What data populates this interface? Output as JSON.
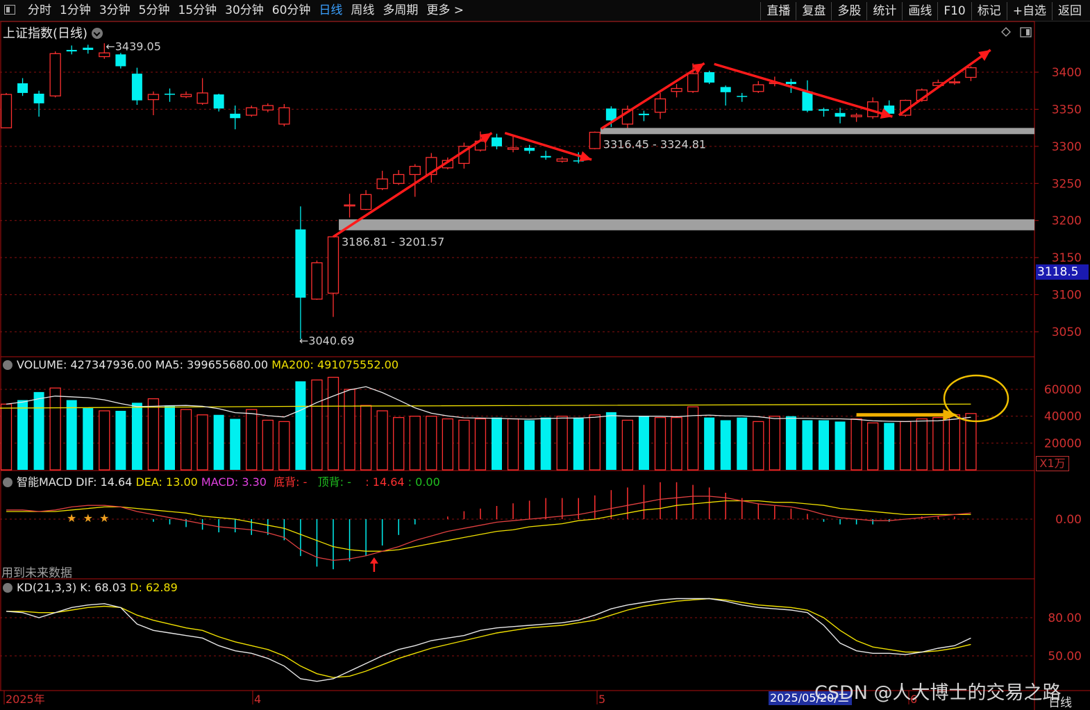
{
  "topbar": {
    "tabs": [
      {
        "label": "分时",
        "active": false
      },
      {
        "label": "1分钟",
        "active": false
      },
      {
        "label": "3分钟",
        "active": false
      },
      {
        "label": "5分钟",
        "active": false
      },
      {
        "label": "15分钟",
        "active": false
      },
      {
        "label": "30分钟",
        "active": false
      },
      {
        "label": "60分钟",
        "active": false
      },
      {
        "label": "日线",
        "active": true
      },
      {
        "label": "周线",
        "active": false
      },
      {
        "label": "多周期",
        "active": false
      },
      {
        "label": "更多 >",
        "active": false
      }
    ],
    "tools": [
      "直播",
      "复盘",
      "多股",
      "统计",
      "画线",
      "F10",
      "标记",
      "+自选",
      "返回"
    ]
  },
  "title": "上证指数(日线)",
  "current_price": "3118.5",
  "volume_label": {
    "volume": "VOLUME: 427347936.00",
    "ma5": "MA5: 399655680.00",
    "ma200": "MA200: 491075552.00"
  },
  "volume_unit": "X1万",
  "macd_label": {
    "name": "智能MACD",
    "dif": "DIF: 14.64",
    "dea": "DEA: 13.00",
    "macd": "MACD: 3.30",
    "bottom": "底背: -",
    "top": "顶背: -",
    "extra1": ": 14.64",
    "extra2": ": 0.00"
  },
  "future_data_note": "用到未来数据",
  "kd_label": {
    "name": "KD(21,3,3)",
    "k": "K: 68.03",
    "d": "D: 62.89"
  },
  "date_highlight": "2025/05/20/二",
  "date_labels": [
    {
      "text": "2025年"
    },
    {
      "text": "4"
    },
    {
      "text": "5"
    },
    {
      "text": "6"
    }
  ],
  "bottom_right": "日线",
  "watermark": "CSDN @人大博士的交易之路",
  "colors": {
    "up": "#ff3030",
    "down": "#00f0f0",
    "ma_white": "#e8e8e8",
    "ma_yellow": "#f0e000",
    "grid": "#8a1010",
    "arrow": "#ff1a1a",
    "zone": "#a0a0a0"
  },
  "chart_data": {
    "type": "candlestick",
    "title": "上证指数(日线)",
    "price_axis": {
      "ticks": [
        3050,
        3100,
        3150,
        3200,
        3250,
        3300,
        3350,
        3400
      ],
      "range": [
        3020,
        3450
      ]
    },
    "annotations": [
      {
        "text": "3439.05",
        "type": "high"
      },
      {
        "text": "3040.69",
        "type": "low"
      },
      {
        "text": "3186.81 - 3201.57",
        "type": "zone",
        "low": 3186.81,
        "high": 3201.57
      },
      {
        "text": "3316.45 - 3324.81",
        "type": "zone",
        "low": 3316.45,
        "high": 3324.81
      }
    ],
    "candles": [
      {
        "o": 3325,
        "c": 3370,
        "h": 3372,
        "l": 3325
      },
      {
        "o": 3385,
        "c": 3372,
        "h": 3392,
        "l": 3368
      },
      {
        "o": 3371,
        "c": 3358,
        "h": 3375,
        "l": 3340
      },
      {
        "o": 3368,
        "c": 3425,
        "h": 3428,
        "l": 3366
      },
      {
        "o": 3430,
        "c": 3428,
        "h": 3436,
        "l": 3424
      },
      {
        "o": 3433,
        "c": 3430,
        "h": 3437,
        "l": 3425
      },
      {
        "o": 3421,
        "c": 3426,
        "h": 3439,
        "l": 3418
      },
      {
        "o": 3424,
        "c": 3408,
        "h": 3426,
        "l": 3405
      },
      {
        "o": 3398,
        "c": 3362,
        "h": 3406,
        "l": 3356
      },
      {
        "o": 3363,
        "c": 3370,
        "h": 3374,
        "l": 3342
      },
      {
        "o": 3371,
        "c": 3370,
        "h": 3378,
        "l": 3360
      },
      {
        "o": 3367,
        "c": 3370,
        "h": 3374,
        "l": 3365
      },
      {
        "o": 3358,
        "c": 3372,
        "h": 3392,
        "l": 3356
      },
      {
        "o": 3370,
        "c": 3351,
        "h": 3371,
        "l": 3347
      },
      {
        "o": 3344,
        "c": 3338,
        "h": 3355,
        "l": 3323
      },
      {
        "o": 3342,
        "c": 3352,
        "h": 3355,
        "l": 3340
      },
      {
        "o": 3349,
        "c": 3355,
        "h": 3358,
        "l": 3346
      },
      {
        "o": 3330,
        "c": 3352,
        "h": 3357,
        "l": 3327
      },
      {
        "o": 3188,
        "c": 3096,
        "h": 3219,
        "l": 3040
      },
      {
        "o": 3094,
        "c": 3143,
        "h": 3146,
        "l": 3093
      },
      {
        "o": 3102,
        "c": 3178,
        "h": 3178,
        "l": 3070
      },
      {
        "o": 3220,
        "c": 3221,
        "h": 3236,
        "l": 3204
      },
      {
        "o": 3215,
        "c": 3235,
        "h": 3241,
        "l": 3214
      },
      {
        "o": 3243,
        "c": 3256,
        "h": 3267,
        "l": 3241
      },
      {
        "o": 3250,
        "c": 3262,
        "h": 3268,
        "l": 3248
      },
      {
        "o": 3262,
        "c": 3273,
        "h": 3276,
        "l": 3232
      },
      {
        "o": 3262,
        "c": 3285,
        "h": 3291,
        "l": 3251
      },
      {
        "o": 3271,
        "c": 3281,
        "h": 3285,
        "l": 3269
      },
      {
        "o": 3277,
        "c": 3300,
        "h": 3305,
        "l": 3270
      },
      {
        "o": 3295,
        "c": 3307,
        "h": 3320,
        "l": 3293
      },
      {
        "o": 3312,
        "c": 3300,
        "h": 3317,
        "l": 3296
      },
      {
        "o": 3296,
        "c": 3298,
        "h": 3314,
        "l": 3292
      },
      {
        "o": 3298,
        "c": 3294,
        "h": 3302,
        "l": 3290
      },
      {
        "o": 3287,
        "c": 3285,
        "h": 3294,
        "l": 3282
      },
      {
        "o": 3280,
        "c": 3283,
        "h": 3286,
        "l": 3278
      },
      {
        "o": 3281,
        "c": 3280,
        "h": 3292,
        "l": 3277
      },
      {
        "o": 3297,
        "c": 3319,
        "h": 3320,
        "l": 3296
      },
      {
        "o": 3351,
        "c": 3335,
        "h": 3354,
        "l": 3326
      },
      {
        "o": 3330,
        "c": 3350,
        "h": 3355,
        "l": 3320
      },
      {
        "o": 3344,
        "c": 3342,
        "h": 3348,
        "l": 3334
      },
      {
        "o": 3346,
        "c": 3364,
        "h": 3372,
        "l": 3337
      },
      {
        "o": 3374,
        "c": 3378,
        "h": 3384,
        "l": 3366
      },
      {
        "o": 3374,
        "c": 3398,
        "h": 3412,
        "l": 3372
      },
      {
        "o": 3400,
        "c": 3386,
        "h": 3402,
        "l": 3384
      },
      {
        "o": 3380,
        "c": 3373,
        "h": 3382,
        "l": 3355
      },
      {
        "o": 3368,
        "c": 3367,
        "h": 3372,
        "l": 3360
      },
      {
        "o": 3374,
        "c": 3383,
        "h": 3388,
        "l": 3372
      },
      {
        "o": 3385,
        "c": 3386,
        "h": 3394,
        "l": 3381
      },
      {
        "o": 3387,
        "c": 3384,
        "h": 3391,
        "l": 3372
      },
      {
        "o": 3374,
        "c": 3348,
        "h": 3389,
        "l": 3346
      },
      {
        "o": 3350,
        "c": 3348,
        "h": 3352,
        "l": 3340
      },
      {
        "o": 3345,
        "c": 3340,
        "h": 3352,
        "l": 3331
      },
      {
        "o": 3340,
        "c": 3342,
        "h": 3345,
        "l": 3333
      },
      {
        "o": 3340,
        "c": 3360,
        "h": 3366,
        "l": 3337
      },
      {
        "o": 3355,
        "c": 3344,
        "h": 3362,
        "l": 3342
      },
      {
        "o": 3342,
        "c": 3362,
        "h": 3363,
        "l": 3340
      },
      {
        "o": 3362,
        "c": 3376,
        "h": 3378,
        "l": 3360
      },
      {
        "o": 3382,
        "c": 3386,
        "h": 3390,
        "l": 3378
      },
      {
        "o": 3386,
        "c": 3387,
        "h": 3392,
        "l": 3383
      },
      {
        "o": 3393,
        "c": 3406,
        "h": 3408,
        "l": 3388
      }
    ],
    "volume_axis": {
      "ticks": [
        20000,
        40000,
        60000
      ],
      "unit": "X1万"
    },
    "volume": [
      49000,
      52000,
      58000,
      61000,
      52000,
      46000,
      44000,
      44000,
      50000,
      53000,
      48000,
      45000,
      41000,
      41000,
      38000,
      45000,
      37000,
      36000,
      66000,
      67000,
      69000,
      60000,
      48000,
      44000,
      39000,
      40000,
      40000,
      38000,
      37000,
      38000,
      39000,
      38000,
      37000,
      39000,
      40000,
      39000,
      41000,
      43000,
      37000,
      40000,
      39000,
      39000,
      47000,
      39000,
      37000,
      39000,
      36000,
      40000,
      40000,
      37000,
      37000,
      36000,
      38000,
      35000,
      35000,
      36000,
      38000,
      39000,
      41000,
      42000
    ],
    "volume_ma200": 49000,
    "macd_axis": {
      "ticks": [
        0.0
      ]
    },
    "kd_axis": {
      "ticks": [
        50.0,
        80.0
      ]
    },
    "kd_k": [
      85,
      84,
      80,
      84,
      88,
      90,
      91,
      88,
      75,
      70,
      68,
      66,
      64,
      58,
      54,
      52,
      48,
      42,
      32,
      30,
      32,
      38,
      44,
      50,
      55,
      58,
      62,
      64,
      66,
      70,
      72,
      73,
      74,
      75,
      76,
      78,
      82,
      87,
      90,
      92,
      94,
      95,
      95,
      95,
      93,
      90,
      88,
      87,
      86,
      84,
      74,
      60,
      54,
      52,
      52,
      51,
      53,
      56,
      58,
      64
    ],
    "kd_d": [
      85,
      85,
      84,
      84,
      86,
      88,
      89,
      88,
      82,
      78,
      75,
      72,
      70,
      65,
      61,
      58,
      55,
      50,
      42,
      36,
      33,
      34,
      38,
      43,
      48,
      52,
      56,
      59,
      62,
      65,
      68,
      70,
      72,
      73,
      74,
      76,
      78,
      82,
      86,
      89,
      91,
      93,
      94,
      95,
      94,
      92,
      90,
      89,
      88,
      86,
      80,
      70,
      62,
      57,
      55,
      53,
      53,
      54,
      56,
      59
    ]
  }
}
